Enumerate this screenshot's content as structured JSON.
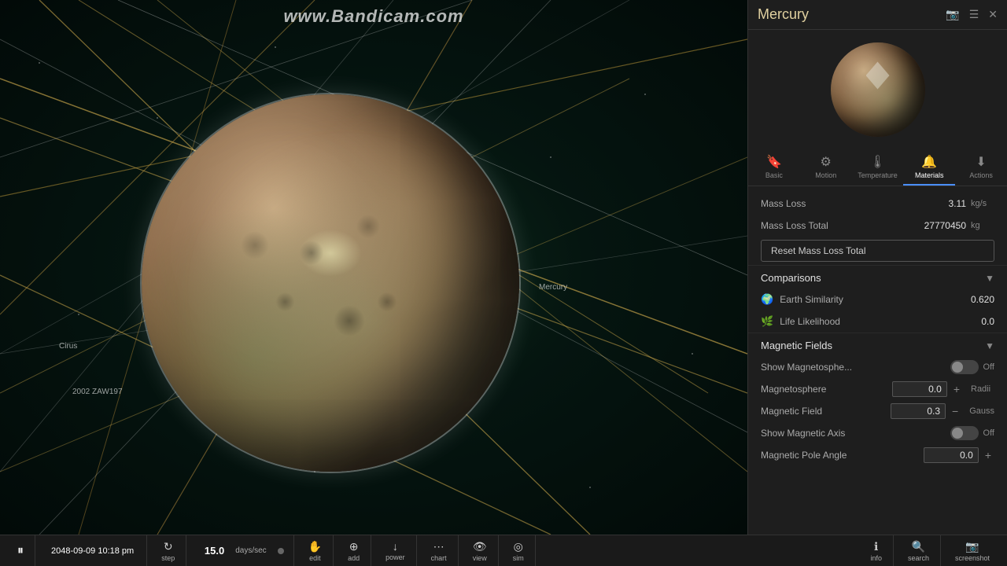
{
  "watermark": "www.Bandicam.com",
  "panel": {
    "title": "Mercury",
    "tabs": [
      {
        "id": "basic",
        "label": "Basic",
        "icon": "🔖"
      },
      {
        "id": "motion",
        "label": "Motion",
        "icon": "⚙"
      },
      {
        "id": "temperature",
        "label": "Temperature",
        "icon": "🌡"
      },
      {
        "id": "materials",
        "label": "Materials",
        "icon": "🔔",
        "active": true
      },
      {
        "id": "actions",
        "label": "Actions",
        "icon": "⬇"
      }
    ],
    "materials": {
      "mass_loss_label": "Mass Loss",
      "mass_loss_value": "3.11",
      "mass_loss_unit": "kg/s",
      "mass_loss_total_label": "Mass Loss Total",
      "mass_loss_total_value": "27770450",
      "mass_loss_total_unit": "kg",
      "reset_button_label": "Reset Mass Loss Total"
    },
    "comparisons": {
      "title": "Comparisons",
      "earth_similarity_label": "Earth Similarity",
      "earth_similarity_value": "0.620",
      "life_likelihood_label": "Life Likelihood",
      "life_likelihood_value": "0.0"
    },
    "magnetic_fields": {
      "title": "Magnetic Fields",
      "show_magnetosphere_label": "Show Magnetosphe...",
      "show_magnetosphere_state": "Off",
      "magnetosphere_label": "Magnetosphere",
      "magnetosphere_value": "0.0",
      "magnetosphere_unit": "Radii",
      "magnetic_field_label": "Magnetic Field",
      "magnetic_field_value": "0.3",
      "magnetic_field_unit": "Gauss",
      "show_magnetic_axis_label": "Show Magnetic Axis",
      "show_magnetic_axis_state": "Off",
      "magnetic_pole_angle_label": "Magnetic Pole Angle",
      "magnetic_pole_angle_value": "0.0"
    }
  },
  "toolbar": {
    "pause_icon": "⏸",
    "time": "2048-09-09 10:18 pm",
    "step_label": "step",
    "speed_value": "15.0",
    "speed_unit": "days/sec",
    "edit_label": "edit",
    "add_label": "add",
    "power_label": "power",
    "chart_label": "chart",
    "view_label": "view",
    "sim_label": "sim",
    "info_label": "info",
    "search_label": "search",
    "screenshot_label": "screenshot"
  },
  "labels": {
    "mercury": "Mercury",
    "cirus": "Cirus",
    "asteroid": "2002 ZAW197"
  },
  "colors": {
    "accent": "#4a8fff",
    "panel_bg": "#1e1e1e",
    "active_tab": "#4a8fff"
  }
}
